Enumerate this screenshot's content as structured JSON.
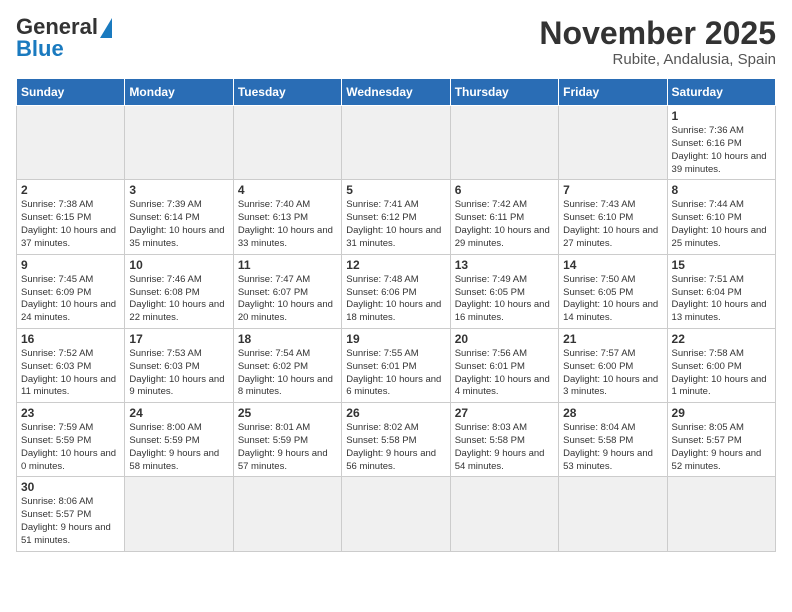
{
  "header": {
    "logo_general": "General",
    "logo_blue": "Blue",
    "logo_sub": "Blue",
    "title": "November 2025",
    "subtitle": "Rubite, Andalusia, Spain"
  },
  "weekdays": [
    "Sunday",
    "Monday",
    "Tuesday",
    "Wednesday",
    "Thursday",
    "Friday",
    "Saturday"
  ],
  "weeks": [
    [
      {
        "day": "",
        "info": ""
      },
      {
        "day": "",
        "info": ""
      },
      {
        "day": "",
        "info": ""
      },
      {
        "day": "",
        "info": ""
      },
      {
        "day": "",
        "info": ""
      },
      {
        "day": "",
        "info": ""
      },
      {
        "day": "1",
        "info": "Sunrise: 7:36 AM\nSunset: 6:16 PM\nDaylight: 10 hours and 39 minutes."
      }
    ],
    [
      {
        "day": "2",
        "info": "Sunrise: 7:38 AM\nSunset: 6:15 PM\nDaylight: 10 hours and 37 minutes."
      },
      {
        "day": "3",
        "info": "Sunrise: 7:39 AM\nSunset: 6:14 PM\nDaylight: 10 hours and 35 minutes."
      },
      {
        "day": "4",
        "info": "Sunrise: 7:40 AM\nSunset: 6:13 PM\nDaylight: 10 hours and 33 minutes."
      },
      {
        "day": "5",
        "info": "Sunrise: 7:41 AM\nSunset: 6:12 PM\nDaylight: 10 hours and 31 minutes."
      },
      {
        "day": "6",
        "info": "Sunrise: 7:42 AM\nSunset: 6:11 PM\nDaylight: 10 hours and 29 minutes."
      },
      {
        "day": "7",
        "info": "Sunrise: 7:43 AM\nSunset: 6:10 PM\nDaylight: 10 hours and 27 minutes."
      },
      {
        "day": "8",
        "info": "Sunrise: 7:44 AM\nSunset: 6:10 PM\nDaylight: 10 hours and 25 minutes."
      }
    ],
    [
      {
        "day": "9",
        "info": "Sunrise: 7:45 AM\nSunset: 6:09 PM\nDaylight: 10 hours and 24 minutes."
      },
      {
        "day": "10",
        "info": "Sunrise: 7:46 AM\nSunset: 6:08 PM\nDaylight: 10 hours and 22 minutes."
      },
      {
        "day": "11",
        "info": "Sunrise: 7:47 AM\nSunset: 6:07 PM\nDaylight: 10 hours and 20 minutes."
      },
      {
        "day": "12",
        "info": "Sunrise: 7:48 AM\nSunset: 6:06 PM\nDaylight: 10 hours and 18 minutes."
      },
      {
        "day": "13",
        "info": "Sunrise: 7:49 AM\nSunset: 6:05 PM\nDaylight: 10 hours and 16 minutes."
      },
      {
        "day": "14",
        "info": "Sunrise: 7:50 AM\nSunset: 6:05 PM\nDaylight: 10 hours and 14 minutes."
      },
      {
        "day": "15",
        "info": "Sunrise: 7:51 AM\nSunset: 6:04 PM\nDaylight: 10 hours and 13 minutes."
      }
    ],
    [
      {
        "day": "16",
        "info": "Sunrise: 7:52 AM\nSunset: 6:03 PM\nDaylight: 10 hours and 11 minutes."
      },
      {
        "day": "17",
        "info": "Sunrise: 7:53 AM\nSunset: 6:03 PM\nDaylight: 10 hours and 9 minutes."
      },
      {
        "day": "18",
        "info": "Sunrise: 7:54 AM\nSunset: 6:02 PM\nDaylight: 10 hours and 8 minutes."
      },
      {
        "day": "19",
        "info": "Sunrise: 7:55 AM\nSunset: 6:01 PM\nDaylight: 10 hours and 6 minutes."
      },
      {
        "day": "20",
        "info": "Sunrise: 7:56 AM\nSunset: 6:01 PM\nDaylight: 10 hours and 4 minutes."
      },
      {
        "day": "21",
        "info": "Sunrise: 7:57 AM\nSunset: 6:00 PM\nDaylight: 10 hours and 3 minutes."
      },
      {
        "day": "22",
        "info": "Sunrise: 7:58 AM\nSunset: 6:00 PM\nDaylight: 10 hours and 1 minute."
      }
    ],
    [
      {
        "day": "23",
        "info": "Sunrise: 7:59 AM\nSunset: 5:59 PM\nDaylight: 10 hours and 0 minutes."
      },
      {
        "day": "24",
        "info": "Sunrise: 8:00 AM\nSunset: 5:59 PM\nDaylight: 9 hours and 58 minutes."
      },
      {
        "day": "25",
        "info": "Sunrise: 8:01 AM\nSunset: 5:59 PM\nDaylight: 9 hours and 57 minutes."
      },
      {
        "day": "26",
        "info": "Sunrise: 8:02 AM\nSunset: 5:58 PM\nDaylight: 9 hours and 56 minutes."
      },
      {
        "day": "27",
        "info": "Sunrise: 8:03 AM\nSunset: 5:58 PM\nDaylight: 9 hours and 54 minutes."
      },
      {
        "day": "28",
        "info": "Sunrise: 8:04 AM\nSunset: 5:58 PM\nDaylight: 9 hours and 53 minutes."
      },
      {
        "day": "29",
        "info": "Sunrise: 8:05 AM\nSunset: 5:57 PM\nDaylight: 9 hours and 52 minutes."
      }
    ],
    [
      {
        "day": "30",
        "info": "Sunrise: 8:06 AM\nSunset: 5:57 PM\nDaylight: 9 hours and 51 minutes."
      },
      {
        "day": "",
        "info": ""
      },
      {
        "day": "",
        "info": ""
      },
      {
        "day": "",
        "info": ""
      },
      {
        "day": "",
        "info": ""
      },
      {
        "day": "",
        "info": ""
      },
      {
        "day": "",
        "info": ""
      }
    ]
  ]
}
